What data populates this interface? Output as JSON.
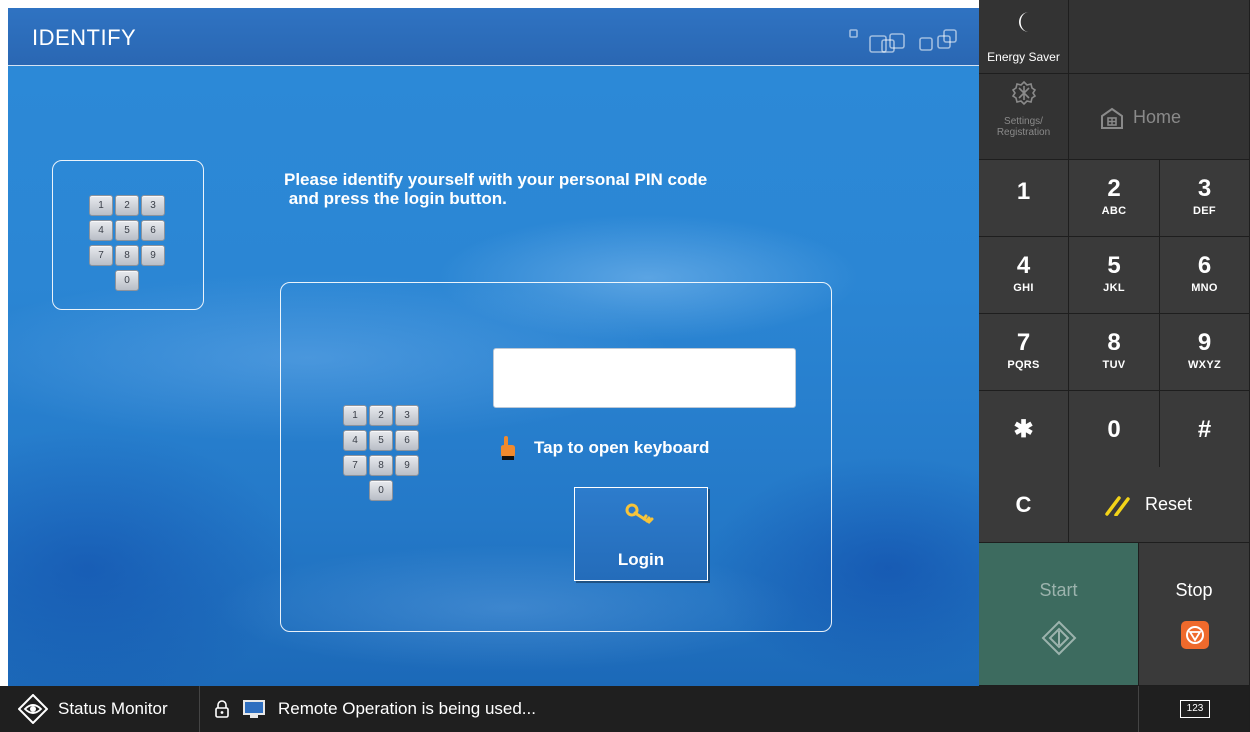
{
  "header": {
    "title": "IDENTIFY"
  },
  "small_keypad": {
    "keys": [
      "1",
      "2",
      "3",
      "4",
      "5",
      "6",
      "7",
      "8",
      "9",
      "0"
    ]
  },
  "main": {
    "instruction": "Please identify yourself with your personal PIN code\n and press the login button.",
    "pin_value": "",
    "keyboard_hint": "Tap to open keyboard",
    "login_label": "Login"
  },
  "side": {
    "energy_saver": "Energy Saver",
    "settings": "Settings/\nRegistration",
    "home": "Home",
    "keys": [
      {
        "digit": "1",
        "letters": ""
      },
      {
        "digit": "2",
        "letters": "ABC"
      },
      {
        "digit": "3",
        "letters": "DEF"
      },
      {
        "digit": "4",
        "letters": "GHI"
      },
      {
        "digit": "5",
        "letters": "JKL"
      },
      {
        "digit": "6",
        "letters": "MNO"
      },
      {
        "digit": "7",
        "letters": "PQRS"
      },
      {
        "digit": "8",
        "letters": "TUV"
      },
      {
        "digit": "9",
        "letters": "WXYZ"
      },
      {
        "digit": "✱",
        "letters": ""
      },
      {
        "digit": "0",
        "letters": ""
      },
      {
        "digit": "#",
        "letters": ""
      }
    ],
    "clear": "C",
    "reset": "Reset",
    "start": "Start",
    "stop": "Stop",
    "input_mode": "123"
  },
  "status": {
    "monitor_label": "Status Monitor",
    "message": "Remote Operation is being used..."
  },
  "colors": {
    "title_bar": "#2a67b3",
    "screen_blue": "#2b86d4",
    "side_panel": "#3a3a3a",
    "start_green": "#3d6b5f",
    "stop_orange": "#ef6a2c",
    "reset_yellow": "#f3d419",
    "status_bar": "#1f1f1f"
  },
  "icons": {
    "energy_saver": "moon-icon",
    "settings": "gear-icon",
    "home": "home-icon",
    "hint": "pointing-hand-icon",
    "login": "key-icon",
    "reset": "reset-slash-icon",
    "start": "start-diamond-icon",
    "stop": "stop-icon",
    "status_monitor": "eye-diamond-icon",
    "lock": "lock-icon",
    "remote": "monitor-icon"
  }
}
